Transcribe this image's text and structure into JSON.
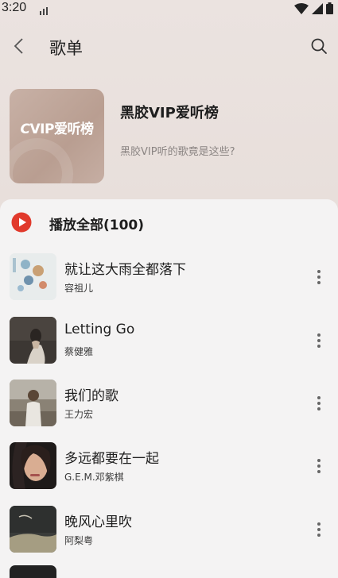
{
  "status_bar": {
    "time": "3:20"
  },
  "app_bar": {
    "title": "歌单",
    "back_icon": "back-chevron-icon",
    "search_icon": "search-icon"
  },
  "playlist": {
    "cover_text": "VIP爱听榜",
    "cover_logo_text": "C",
    "title": "黑胶VIP爱听榜",
    "description": "黑胶VIP听的歌竟是这些?"
  },
  "play_all": {
    "label": "播放全部(100)",
    "accent": "#e13a2c"
  },
  "songs": [
    {
      "title": "就让这大雨全都落下",
      "artist": "容祖儿"
    },
    {
      "title": "Letting Go",
      "artist": "蔡健雅"
    },
    {
      "title": "我们的歌",
      "artist": "王力宏"
    },
    {
      "title": "多远都要在一起",
      "artist": "G.E.M.邓紫棋"
    },
    {
      "title": "晚风心里吹",
      "artist": "阿梨粤"
    }
  ]
}
